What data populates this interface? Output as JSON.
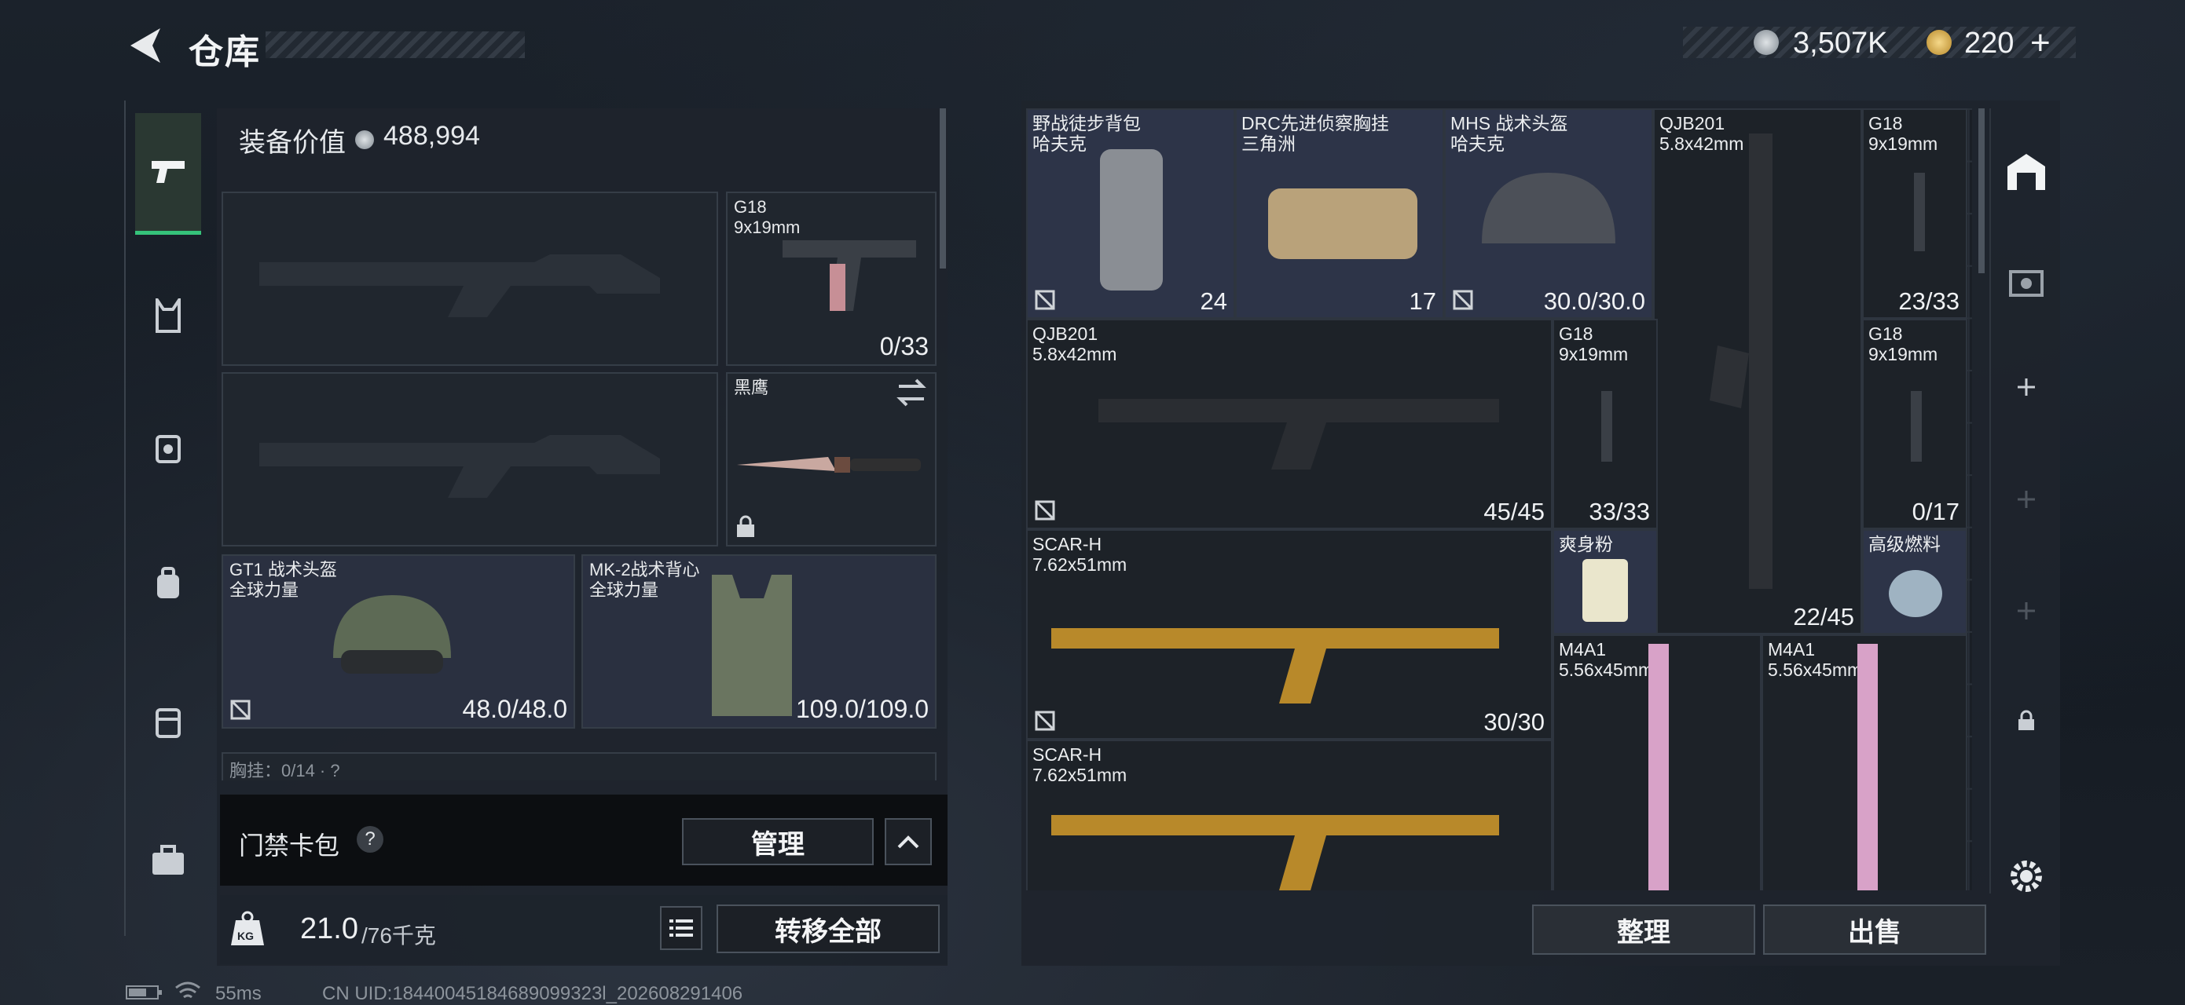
{
  "header": {
    "title": "仓库",
    "currency1": "3,507K",
    "currency2": "220",
    "currency2_plus": "+"
  },
  "loadout": {
    "equip_value_label": "装备价值",
    "equip_value": "488,994",
    "slots": [
      {
        "name": "G18",
        "caliber": "9x19mm",
        "count": "0/33"
      },
      {
        "name": "黑鹰"
      },
      {
        "name": "GT1 战术头盔",
        "brand": "全球力量",
        "count": "48.0/48.0"
      },
      {
        "name": "MK-2战术背心",
        "brand": "全球力量",
        "count": "109.0/109.0"
      }
    ],
    "chest_partial": "胸挂：0/14 · ?",
    "card_pack": "门禁卡包",
    "card_help": "?",
    "manage": "管理",
    "weight": "21.0",
    "weight_cap": "/76千克",
    "weight_icon_text": "KG",
    "transfer_all": "转移全部"
  },
  "stash": {
    "items": [
      {
        "name": "野战徒步背包",
        "sub": "哈夫克",
        "count": "24"
      },
      {
        "name": "DRC先进侦察胸挂",
        "sub": "三角洲",
        "count": "17"
      },
      {
        "name": "MHS 战术头盔",
        "sub": "哈夫克",
        "count": "30.0/30.0"
      },
      {
        "name": "QJB201",
        "sub": "5.8x42mm",
        "count": "22/45"
      },
      {
        "name": "G18",
        "sub": "9x19mm",
        "count": "23/33"
      },
      {
        "name": "QJB201",
        "sub": "5.8x42mm",
        "count": "45/45"
      },
      {
        "name": "G18",
        "sub": "9x19mm",
        "count": "33/33"
      },
      {
        "name": "G18",
        "sub": "9x19mm",
        "count": "0/17"
      },
      {
        "name": "SCAR-H",
        "sub": "7.62x51mm",
        "count": "30/30"
      },
      {
        "name": "爽身粉",
        "sub": "",
        "count": ""
      },
      {
        "name": "高级燃料",
        "sub": "",
        "count": ""
      },
      {
        "name": "M4A1",
        "sub": "5.56x45mm",
        "count": ""
      },
      {
        "name": "M4A1",
        "sub": "5.56x45mm",
        "count": ""
      },
      {
        "name": "SCAR-H",
        "sub": "7.62x51mm",
        "count": ""
      }
    ],
    "sort": "整理",
    "sell": "出售"
  },
  "footer": {
    "ping": "55ms",
    "uid": "CN UID:18440045184689099323l_202608291406"
  },
  "colors": {
    "accent_green": "#35c27a",
    "item_blue": "#2d3448",
    "gold": "#b8892a"
  }
}
